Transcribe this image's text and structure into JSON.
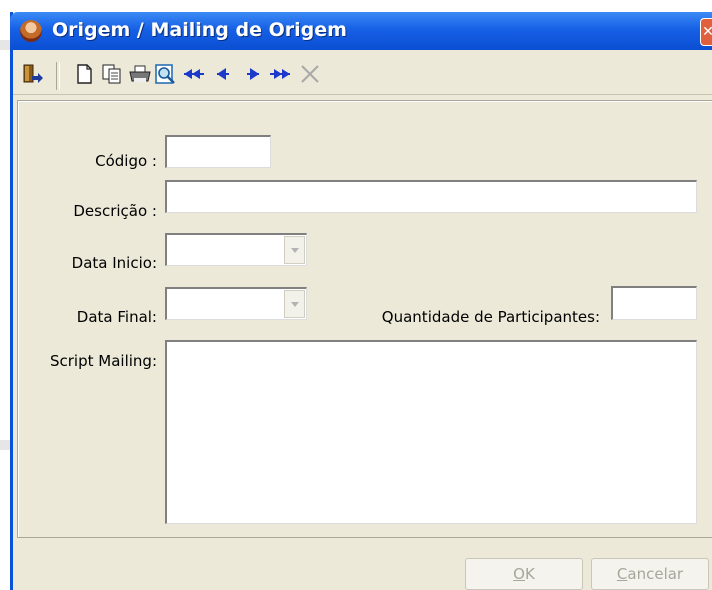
{
  "window": {
    "title": "Origem / Mailing de  Origem",
    "close_glyph": "✕"
  },
  "toolbar": {
    "buttons": [
      {
        "name": "exit-icon"
      },
      {
        "name": "new-document-icon"
      },
      {
        "name": "copy-icon"
      },
      {
        "name": "print-icon"
      },
      {
        "name": "search-preview-icon"
      },
      {
        "name": "first-record-icon"
      },
      {
        "name": "previous-record-icon"
      },
      {
        "name": "next-record-icon"
      },
      {
        "name": "last-record-icon"
      },
      {
        "name": "delete-icon"
      }
    ]
  },
  "form": {
    "codigo": {
      "label": "Código :",
      "value": ""
    },
    "descricao": {
      "label": "Descrição :",
      "value": ""
    },
    "data_inicio": {
      "label": "Data Inicio:",
      "value": ""
    },
    "data_final": {
      "label": "Data Final:",
      "value": ""
    },
    "quantidade": {
      "label": "Quantidade de Participantes:",
      "value": ""
    },
    "script": {
      "label": "Script Mailing:",
      "value": ""
    }
  },
  "buttons": {
    "ok_accel": "O",
    "ok_rest": "K",
    "cancel_accel": "C",
    "cancel_rest": "ancelar"
  },
  "colors": {
    "titlebar": "#0b4fd2",
    "window_bg": "#ece9d8",
    "disabled_text": "#a7a69b"
  }
}
